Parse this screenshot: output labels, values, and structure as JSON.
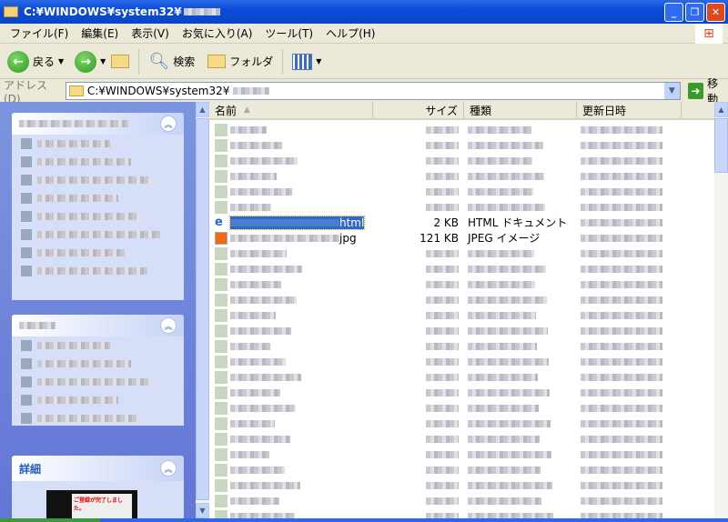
{
  "window": {
    "title": "C:¥WINDOWS¥system32¥"
  },
  "menu": [
    "ファイル(F)",
    "編集(E)",
    "表示(V)",
    "お気に入り(A)",
    "ツール(T)",
    "ヘルプ(H)"
  ],
  "toolbar": {
    "back": "戻る",
    "search": "検索",
    "folders": "フォルダ"
  },
  "address": {
    "label": "アドレス(D)",
    "value": "C:¥WINDOWS¥system32¥",
    "go": "移動"
  },
  "left_pane": {
    "details_title": "詳細",
    "preview_text": "ご登録が完了しました。"
  },
  "columns": {
    "name": "名前",
    "size": "サイズ",
    "type": "種類",
    "modified": "更新日時"
  },
  "files": [
    {
      "name_suffix": "html",
      "size": "2 KB",
      "type": "HTML ドキュメント",
      "selected": true
    },
    {
      "name_suffix": "jpg",
      "size": "121 KB",
      "type": "JPEG イメージ",
      "selected": false
    }
  ]
}
